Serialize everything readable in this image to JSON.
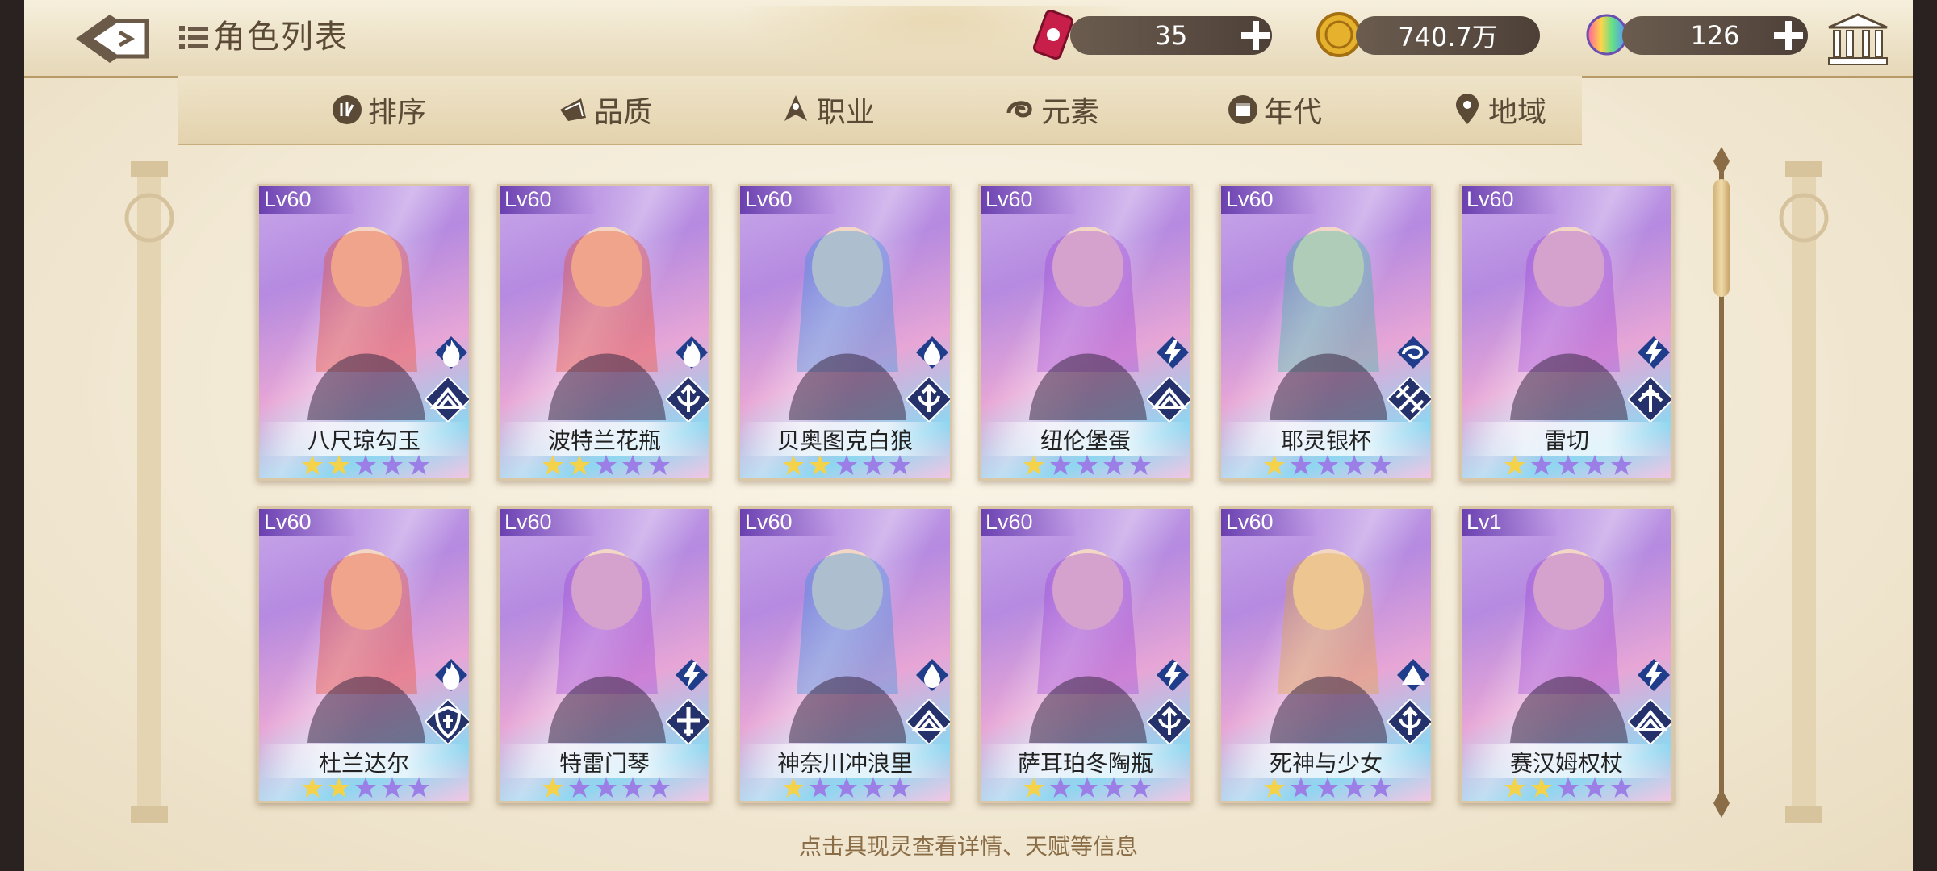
{
  "header": {
    "title": "角色列表",
    "resources": [
      {
        "icon": "ticket-icon",
        "value": "35"
      },
      {
        "icon": "gold-coin-icon",
        "value": "740.7万"
      },
      {
        "icon": "rainbow-crystal-icon",
        "value": "126"
      }
    ]
  },
  "filters": [
    {
      "icon": "sort-icon",
      "label": "排序"
    },
    {
      "icon": "quality-icon",
      "label": "品质"
    },
    {
      "icon": "class-icon",
      "label": "职业"
    },
    {
      "icon": "element-icon",
      "label": "元素"
    },
    {
      "icon": "era-icon",
      "label": "年代"
    },
    {
      "icon": "region-icon",
      "label": "地域"
    }
  ],
  "cards": [
    {
      "level": "Lv60",
      "name": "八尺琼勾玉",
      "stars": 2,
      "element": "fire",
      "class": "book"
    },
    {
      "level": "Lv60",
      "name": "波特兰花瓶",
      "stars": 2,
      "element": "fire",
      "class": "archer"
    },
    {
      "level": "Lv60",
      "name": "贝奥图克白狼",
      "stars": 2,
      "element": "water",
      "class": "archer"
    },
    {
      "level": "Lv60",
      "name": "纽伦堡蛋",
      "stars": 1,
      "element": "thunder",
      "class": "book"
    },
    {
      "level": "Lv60",
      "name": "耶灵银杯",
      "stars": 1,
      "element": "wind",
      "class": "swords"
    },
    {
      "level": "Lv60",
      "name": "雷切",
      "stars": 1,
      "element": "thunder",
      "class": "sword"
    },
    {
      "level": "Lv60",
      "name": "杜兰达尔",
      "stars": 2,
      "element": "fire",
      "class": "shield"
    },
    {
      "level": "Lv60",
      "name": "特雷门琴",
      "stars": 1,
      "element": "thunder",
      "class": "cross"
    },
    {
      "level": "Lv60",
      "name": "神奈川冲浪里",
      "stars": 1,
      "element": "water",
      "class": "book"
    },
    {
      "level": "Lv60",
      "name": "萨耳珀冬陶瓶",
      "stars": 1,
      "element": "thunder",
      "class": "archer"
    },
    {
      "level": "Lv60",
      "name": "死神与少女",
      "stars": 1,
      "element": "earth",
      "class": "archer"
    },
    {
      "level": "Lv1",
      "name": "赛汉姆权杖",
      "stars": 2,
      "element": "thunder",
      "class": "book"
    }
  ],
  "colors": {
    "fire": "#e8441c",
    "water": "#2a8fe0",
    "thunder": "#9a3fd6",
    "wind": "#2fb89a",
    "earth": "#e0a22a",
    "star_on": "#f4d24a",
    "star_off": "#9b7fe6"
  },
  "hint": "点击具现灵查看详情、天赋等信息"
}
